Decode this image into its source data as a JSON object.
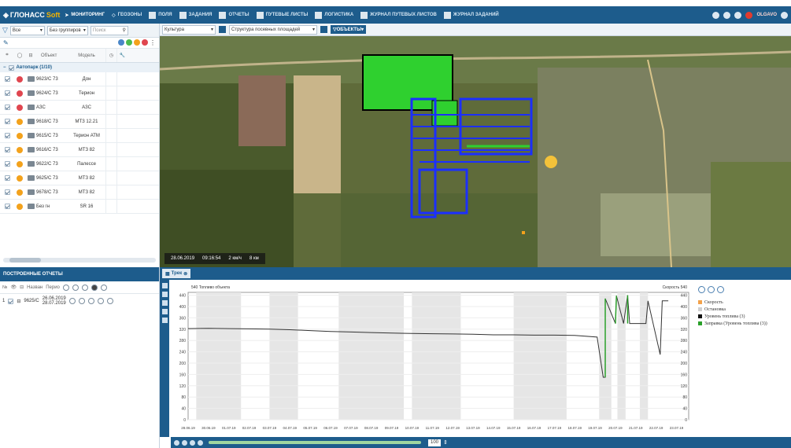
{
  "nav": {
    "logo_main": "ГЛОНАСС",
    "logo_soft": "Soft",
    "items": [
      {
        "label": "МОНИТОРИНГ",
        "active": true
      },
      {
        "label": "ГЕОЗОНЫ",
        "active": false
      },
      {
        "label": "ПОЛЯ",
        "active": false
      },
      {
        "label": "ЗАДАНИЯ",
        "active": false
      },
      {
        "label": "ОТЧЕТЫ",
        "active": false
      },
      {
        "label": "ПУТЕВЫЕ ЛИСТЫ",
        "active": false
      },
      {
        "label": "ЛОГИСТИКА",
        "active": false
      },
      {
        "label": "ЖУРНАЛ ПУТЕВЫХ ЛИСТОВ",
        "active": false
      },
      {
        "label": "ЖУРНАЛ ЗАДАНИЙ",
        "active": false
      }
    ],
    "user": "OLGAVO"
  },
  "objects_panel": {
    "filter_all": "Все",
    "grouping": "Без группиров",
    "search_placeholder": "Поиск",
    "col_object": "Объект",
    "col_model": "Модель",
    "group_label": "Автопарк (1/10)",
    "status_colors": {
      "red": "#e0464f",
      "orange": "#f3a21c",
      "green": "#4cbb4f",
      "blue": "#4a86c8"
    },
    "rows": [
      {
        "object": "9623/С 73",
        "model": "Дон",
        "status": "red"
      },
      {
        "object": "9624/С 73",
        "model": "Терион",
        "status": "red"
      },
      {
        "object": "АЗС",
        "model": "АЗС",
        "status": "red"
      },
      {
        "object": "9618/С 73",
        "model": "МТЗ 12.21",
        "status": "orange"
      },
      {
        "object": "9615/С 73",
        "model": "Терион АТМ",
        "status": "orange"
      },
      {
        "object": "9616/С 73",
        "model": "МТЗ 82",
        "status": "orange"
      },
      {
        "object": "9622/С 73",
        "model": "Палессе",
        "status": "orange"
      },
      {
        "object": "9625/С 73",
        "model": "МТЗ 82",
        "status": "orange"
      },
      {
        "object": "9678/С 73",
        "model": "МТЗ 82",
        "status": "orange"
      },
      {
        "object": "Без гн",
        "model": "SR 16",
        "status": "orange"
      }
    ]
  },
  "map_toolbar": {
    "crop_label": "Культура",
    "structure_label": "Структура посевных площадей",
    "objects_button": "ОБЪЕКТЫ"
  },
  "map_status": {
    "date": "28.06.2019",
    "time": "09:16:54",
    "speed": "2 км/ч",
    "extra": "8 км"
  },
  "reports": {
    "title": "ПОСТРОЕННЫЕ ОТЧЕТЫ",
    "col_name": "Назван",
    "col_period": "Перио",
    "rows": [
      {
        "index": "1",
        "name": "9625/С",
        "period_from": "26.06.2019",
        "period_to": "28.07.2019"
      }
    ]
  },
  "track": {
    "tab_label": "Трек",
    "legend": [
      {
        "label": "Скорость",
        "color": "#f3a24a"
      },
      {
        "label": "Остановка",
        "color": "#cfcfcf"
      },
      {
        "label": "Уровень топлива (3)",
        "color": "#111111"
      },
      {
        "label": "Заправка (Уровень топлива (3))",
        "color": "#2aa02a"
      }
    ],
    "zoom": "100"
  },
  "chart_data": {
    "type": "line",
    "title": "",
    "ylabel_left": "Топливо объекта",
    "ylabel_right": "Скорость",
    "y_unit_left": "540",
    "y_unit_right": "540",
    "ylim": [
      0,
      450
    ],
    "yticks": [
      0,
      40,
      80,
      120,
      160,
      200,
      240,
      280,
      320,
      360,
      400,
      440
    ],
    "x_ticks": [
      "28.06.19",
      "30.06.19",
      "01.07.19",
      "02.07.19",
      "03.07.19",
      "04.07.19",
      "05.07.19",
      "06.07.19",
      "07.07.19",
      "08.07.19",
      "09.07.19",
      "10.07.19",
      "11.07.19",
      "12.07.19",
      "13.07.19",
      "14.07.19",
      "15.07.19",
      "16.07.19",
      "17.07.19",
      "18.07.19",
      "19.07.19",
      "20.07.19",
      "21.07.19",
      "22.07.19",
      "23.07.19"
    ],
    "series": [
      {
        "name": "Уровень топлива (3)",
        "x": [
          0,
          1,
          2,
          3,
          4,
          5,
          6,
          7,
          8,
          9,
          10,
          11,
          12,
          13,
          14,
          15,
          16,
          17,
          18,
          19,
          20.1,
          20.4,
          20.5,
          20.5,
          21.0,
          21.05,
          21.4,
          21.6,
          21.7,
          22.5,
          22.6,
          23.2,
          23.3,
          23.6
        ],
        "y": [
          322,
          323,
          322,
          321,
          320,
          318,
          315,
          312,
          310,
          308,
          306,
          305,
          304,
          303,
          302,
          300,
          300,
          299,
          299,
          298,
          292,
          150,
          150,
          428,
          340,
          438,
          340,
          440,
          340,
          340,
          420,
          230,
          420,
          420
        ]
      }
    ]
  }
}
